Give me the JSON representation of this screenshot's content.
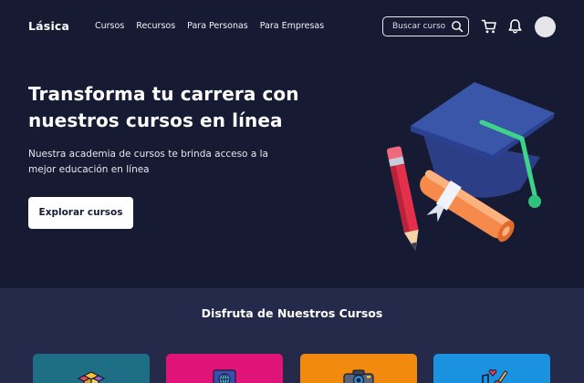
{
  "header": {
    "brand": "Lásica",
    "nav": [
      "Cursos",
      "Recursos",
      "Para Personas",
      "Para Empresas"
    ],
    "search_placeholder": "Buscar curso",
    "icons": [
      "search-icon",
      "cart-icon",
      "bell-icon"
    ]
  },
  "hero": {
    "headline_line1": "Transforma tu carrera con",
    "headline_line2": "nuestros cursos en línea",
    "subtext_line1": "Nuestra academia de cursos te brinda acceso a la",
    "subtext_line2": "mejor educación en línea",
    "cta_label": "Explorar cursos",
    "illustration": "graduation-cap-icon"
  },
  "courses": {
    "title": "Disfruta de Nuestros Cursos",
    "cards": [
      {
        "color": "#1e6e86",
        "icon": "cubes-icon"
      },
      {
        "color": "#e01379",
        "icon": "globe-book-icon"
      },
      {
        "color": "#f28a0f",
        "icon": "camera-icon"
      },
      {
        "color": "#1b92e0",
        "icon": "music-note-heart-icon"
      }
    ]
  },
  "colors": {
    "hero_bg": "#161a33",
    "section_bg": "#262a4a",
    "cta_bg": "#ffffff"
  }
}
